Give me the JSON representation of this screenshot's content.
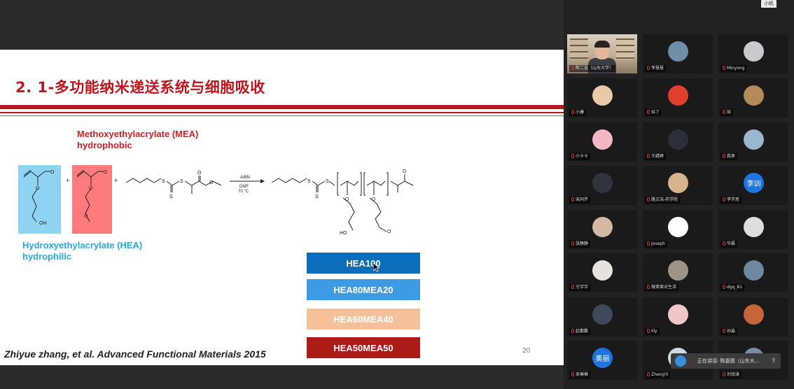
{
  "slide": {
    "title": "2. 1-多功能纳米递送系统与细胞吸收",
    "mea_line1": "Methoxyethylacrylate (MEA)",
    "mea_line2": "hydrophobic",
    "hea_line1": "Hydroxyethylacrylate (HEA)",
    "hea_line2": "hydrophilic",
    "reaction": {
      "reagent1": "AIBN",
      "reagent2": "DMF",
      "temp": "70 °C"
    },
    "atoms": {
      "oh": "OH",
      "o": "O",
      "s": "S",
      "plus": "+"
    },
    "copolymers": [
      "HEA100",
      "HEA80MEA20",
      "HEA60MEA40",
      "HEA50MEA50"
    ],
    "copolymer_colors": [
      "#0a6ebd",
      "#3d9be6",
      "#f4c19b",
      "#ad1b17"
    ],
    "citation": "Zhiyue zhang, et al. Advanced Functional Materials 2015",
    "page_number": "20"
  },
  "panel": {
    "view_tag": "小帆",
    "participants": [
      {
        "name": "陈二吉（山东大学）",
        "type": "camera"
      },
      {
        "name": "李慧慧",
        "type": "avatar",
        "avatar_color": "#6f8ea8"
      },
      {
        "name": "Minyong",
        "type": "avatar",
        "avatar_color": "#c9c9cf"
      },
      {
        "name": "小康",
        "type": "avatar",
        "avatar_color": "#e9c9a8"
      },
      {
        "name": "似了",
        "type": "avatar",
        "avatar_color": "#e0402b"
      },
      {
        "name": "如",
        "type": "avatar",
        "avatar_color": "#b58a5a"
      },
      {
        "name": "小々々",
        "type": "avatar",
        "avatar_color": "#f3b6c2"
      },
      {
        "name": "王婧婷",
        "type": "avatar",
        "avatar_color": "#2a2f3a"
      },
      {
        "name": "我男",
        "type": "avatar",
        "avatar_color": "#9bb6cf"
      },
      {
        "name": "宋同芹",
        "type": "avatar",
        "avatar_color": "#30343f"
      },
      {
        "name": "路文浩-药学院",
        "type": "avatar",
        "avatar_color": "#d7b48d"
      },
      {
        "name": "李学思",
        "type": "initials",
        "initials": "李训",
        "avatar_color": "#1e74e0"
      },
      {
        "name": "张静静",
        "type": "avatar",
        "avatar_color": "#d5b8a3"
      },
      {
        "name": "Joseph",
        "type": "avatar",
        "avatar_color": "#ffffff"
      },
      {
        "name": "华晨",
        "type": "avatar",
        "avatar_color": "#dedede"
      },
      {
        "name": "万宇宇",
        "type": "avatar",
        "avatar_color": "#e6e2dc"
      },
      {
        "name": "微笑面对生活",
        "type": "avatar",
        "avatar_color": "#9e9486"
      },
      {
        "name": "dgq_81",
        "type": "avatar",
        "avatar_color": "#6f88a0"
      },
      {
        "name": "赵鹏鹏",
        "type": "avatar",
        "avatar_color": "#3d4a5a"
      },
      {
        "name": "lily",
        "type": "avatar",
        "avatar_color": "#f1c6c9"
      },
      {
        "name": "孙淼",
        "type": "avatar",
        "avatar_color": "#c7653a"
      },
      {
        "name": "吴琳琳",
        "type": "initials",
        "initials": "奥丽",
        "avatar_color": "#1e74e0"
      },
      {
        "name": "ZhengYi",
        "type": "avatar",
        "avatar_color": "#cfd9e3"
      },
      {
        "name": "刘润涛",
        "type": "avatar",
        "avatar_color": "#7a8aa8"
      }
    ],
    "toast": "正在讲话: 陈嘉德（山东大..."
  }
}
